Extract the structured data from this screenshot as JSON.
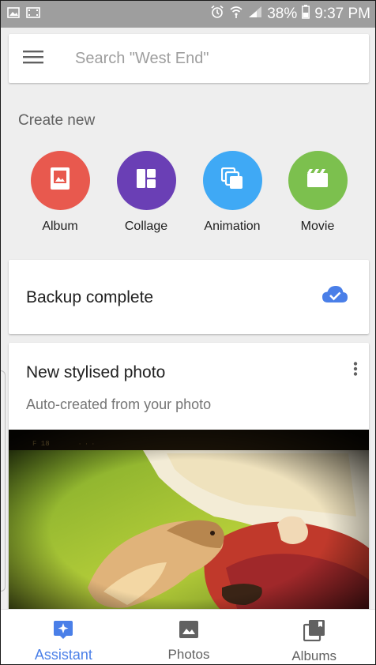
{
  "status_bar": {
    "battery_percent": "38%",
    "time": "9:37 PM"
  },
  "search": {
    "placeholder": "Search \"West End\""
  },
  "create_new": {
    "title": "Create new",
    "items": [
      {
        "label": "Album",
        "color": "#E8594E",
        "icon": "album-icon"
      },
      {
        "label": "Collage",
        "color": "#6A3FB5",
        "icon": "collage-icon"
      },
      {
        "label": "Animation",
        "color": "#3FA9F5",
        "icon": "animation-icon"
      },
      {
        "label": "Movie",
        "color": "#7CC04E",
        "icon": "movie-icon"
      }
    ]
  },
  "backup_card": {
    "text": "Backup complete",
    "icon": "cloud-done-icon",
    "icon_color": "#4A7FE8"
  },
  "stylised_card": {
    "title": "New stylised photo",
    "subtitle": "Auto-created from your photo",
    "menu_icon": "more-vert-icon"
  },
  "bottom_nav": {
    "items": [
      {
        "label": "Assistant",
        "icon": "assistant-icon",
        "active": true
      },
      {
        "label": "Photos",
        "icon": "photo-icon",
        "active": false
      },
      {
        "label": "Albums",
        "icon": "albums-icon",
        "active": false
      }
    ],
    "active_color": "#4A7FE8",
    "inactive_color": "#616161"
  }
}
